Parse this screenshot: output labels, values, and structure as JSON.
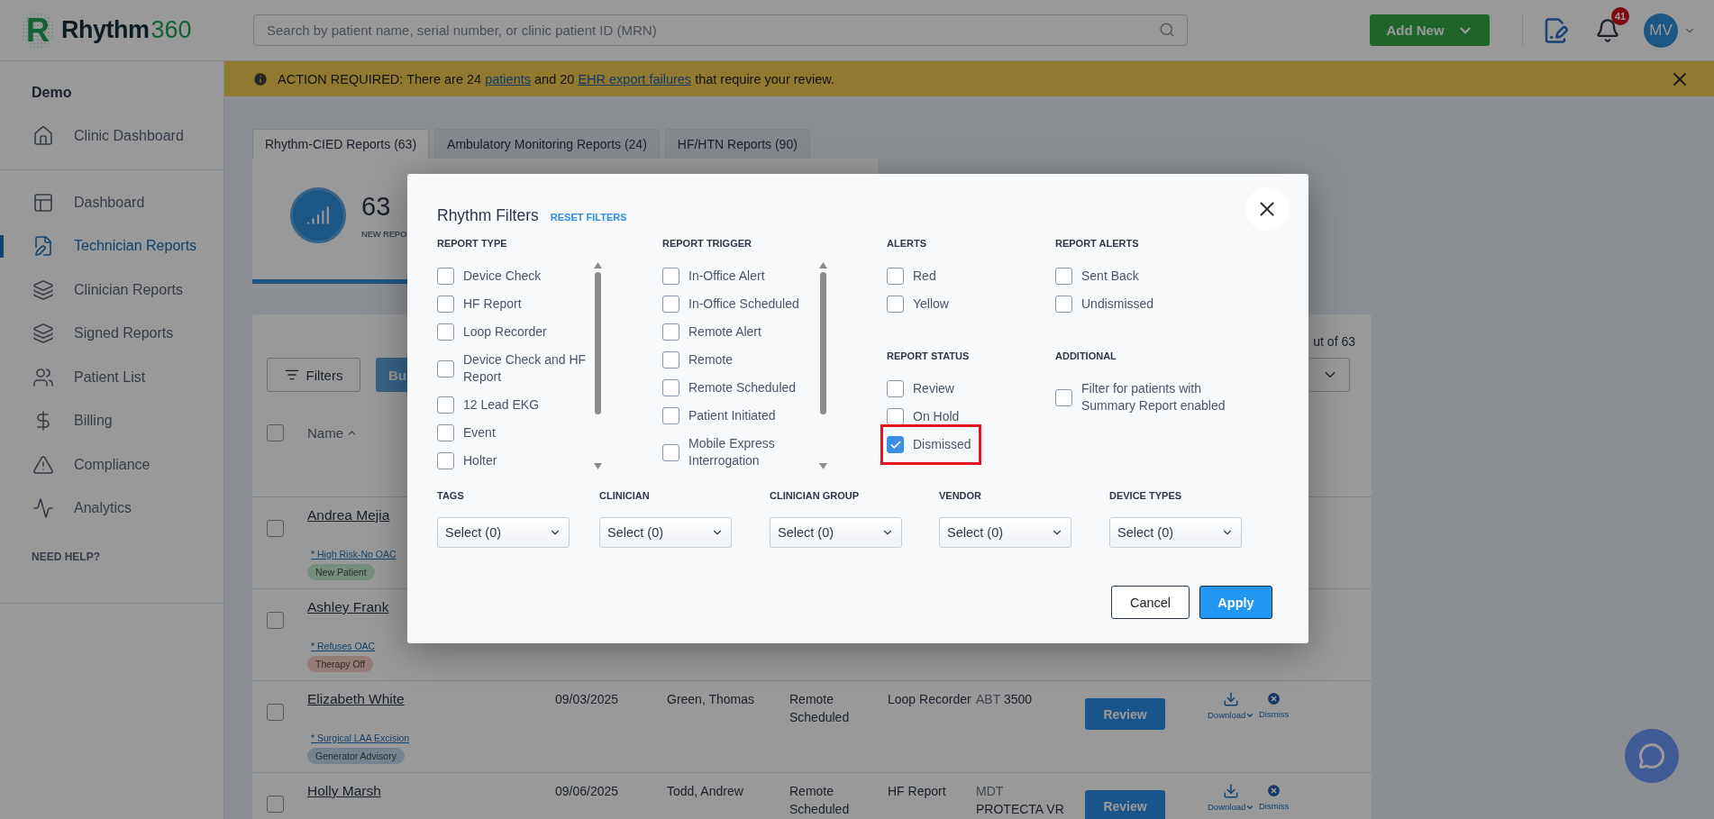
{
  "header": {
    "logo": {
      "mark": "R",
      "name": "Rhythm",
      "suffix": "360"
    },
    "search": {
      "placeholder": "Search by patient name, serial number, or clinic patient ID (MRN)"
    },
    "add_button": "Add New",
    "notifications": "41",
    "avatar": "MV"
  },
  "banner": {
    "segments": [
      {
        "text": "ACTION REQUIRED: There are 24 ",
        "link": false
      },
      {
        "text": "patients",
        "link": true
      },
      {
        "text": " and 20 ",
        "link": false
      },
      {
        "text": "EHR export failures",
        "link": true
      },
      {
        "text": " that require your review.",
        "link": false
      }
    ]
  },
  "sidebar": {
    "heading": "Demo",
    "groups": [
      {
        "items": [
          {
            "label": "Clinic Dashboard",
            "selected": false
          }
        ]
      },
      {
        "items": [
          {
            "label": "Dashboard",
            "selected": false
          },
          {
            "label": "Technician Reports",
            "selected": true
          },
          {
            "label": "Clinician Reports",
            "selected": false
          },
          {
            "label": "Signed Reports",
            "selected": false
          },
          {
            "label": "Patient List",
            "selected": false
          },
          {
            "label": "Billing",
            "selected": false
          },
          {
            "label": "Compliance",
            "selected": false
          },
          {
            "label": "Analytics",
            "selected": false
          }
        ]
      }
    ],
    "help": "NEED HELP?"
  },
  "tabs": [
    {
      "label": "Rhythm-CIED Reports (63)",
      "selected": true
    },
    {
      "label": "Ambulatory Monitoring Reports (24)",
      "selected": false
    },
    {
      "label": "HF/HTN Reports (90)",
      "selected": false
    }
  ],
  "summary": {
    "count": "63",
    "label": "NEW REPO"
  },
  "toolbar": {
    "filters": "Filters",
    "bulk": "Bu",
    "range": "ut of 63"
  },
  "table": {
    "select_all": false,
    "name_column": {
      "label": "Name",
      "sorted_ascending": true
    },
    "rows": [
      {
        "checked": false,
        "name": "Andrea Mejia",
        "note": "* High Risk-No OAC",
        "tag": {
          "label": "New Patient",
          "color": "#758d7d"
        }
      },
      {
        "checked": false,
        "name": "Ashley Frank",
        "note": "* Refuses OAC",
        "tag": {
          "label": "Therapy Off",
          "color": "#947c78"
        }
      },
      {
        "checked": false,
        "name": "Elizabeth White",
        "note": "* Surgical LAA Excision",
        "tag": {
          "label": "Generator Advisory",
          "color": "#778290"
        },
        "date": "09/03/2025",
        "clinician": "Green, Thomas",
        "trigger": "Remote Scheduled",
        "type": "Loop Recorder",
        "device": {
          "maker": "ABT",
          "model": "3500"
        },
        "actions": {
          "review": "Review",
          "download": "Download",
          "dismiss": "Dismiss"
        }
      },
      {
        "checked": false,
        "name": "Holly Marsh",
        "date": "09/06/2025",
        "clinician": "Todd, Andrew",
        "trigger": "Remote Scheduled",
        "type": "HF Report",
        "device": {
          "maker": "MDT",
          "model": "PROTECTA VR"
        },
        "actions": {
          "review": "Review",
          "download": "Download",
          "dismiss": "Dismiss"
        }
      }
    ]
  },
  "modal": {
    "title": "Rhythm Filters",
    "reset": "RESET FILTERS",
    "columns": [
      {
        "groups": [
          {
            "title": "REPORT TYPE",
            "scrollbar": true,
            "options": [
              {
                "label": "Device Check",
                "checked": false
              },
              {
                "label": "HF Report",
                "checked": false
              },
              {
                "label": "Loop Recorder",
                "checked": false
              },
              {
                "label": "Device Check and HF Report",
                "checked": false
              },
              {
                "label": "12 Lead EKG",
                "checked": false
              },
              {
                "label": "Event",
                "checked": false
              },
              {
                "label": "Holter",
                "checked": false
              }
            ]
          }
        ]
      },
      {
        "groups": [
          {
            "title": "REPORT TRIGGER",
            "scrollbar": true,
            "options": [
              {
                "label": "In-Office Alert",
                "checked": false
              },
              {
                "label": "In-Office Scheduled",
                "checked": false
              },
              {
                "label": "Remote Alert",
                "checked": false
              },
              {
                "label": "Remote",
                "checked": false
              },
              {
                "label": "Remote Scheduled",
                "checked": false
              },
              {
                "label": "Patient Initiated",
                "checked": false
              },
              {
                "label": "Mobile Express Interrogation",
                "checked": false
              }
            ]
          }
        ]
      },
      {
        "groups": [
          {
            "title": "ALERTS",
            "options": [
              {
                "label": "Red",
                "checked": false
              },
              {
                "label": "Yellow",
                "checked": false
              }
            ]
          },
          {
            "title": "REPORT STATUS",
            "options": [
              {
                "label": "Review",
                "checked": false
              },
              {
                "label": "On Hold",
                "checked": false
              },
              {
                "label": "Dismissed",
                "checked": true,
                "highlighted": true
              }
            ]
          }
        ]
      },
      {
        "groups": [
          {
            "title": "REPORT ALERTS",
            "options": [
              {
                "label": "Sent Back",
                "checked": false
              },
              {
                "label": "Undismissed",
                "checked": false
              }
            ]
          },
          {
            "title": "ADDITIONAL",
            "options": [
              {
                "label": "Filter for patients with Summary Report enabled",
                "checked": false
              }
            ]
          }
        ]
      }
    ],
    "selects": [
      {
        "label": "TAGS",
        "value": "Select (0)"
      },
      {
        "label": "CLINICIAN",
        "value": "Select (0)"
      },
      {
        "label": "CLINICIAN GROUP",
        "value": "Select (0)"
      },
      {
        "label": "VENDOR",
        "value": "Select (0)"
      },
      {
        "label": "DEVICE TYPES",
        "value": "Select (0)"
      }
    ],
    "cancel": "Cancel",
    "apply": "Apply"
  }
}
